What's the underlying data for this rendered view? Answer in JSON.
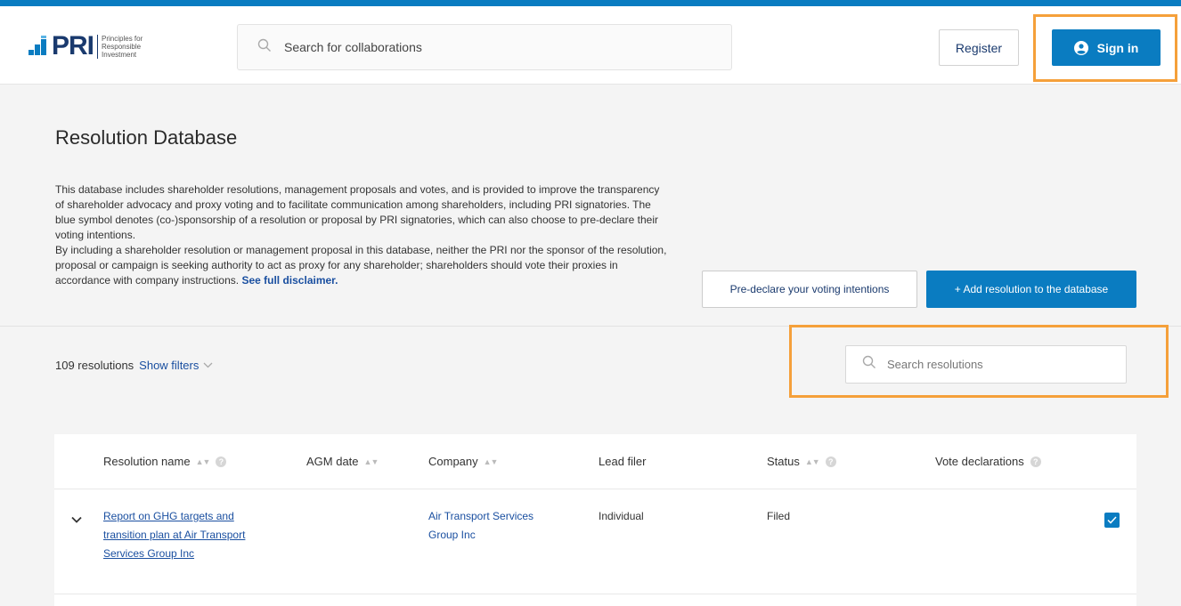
{
  "brand": {
    "name": "PRI",
    "subtitle_lines": [
      "Principles for",
      "Responsible",
      "Investment"
    ],
    "accent": "#0a7cc1"
  },
  "header": {
    "search_placeholder": "Search for collaborations",
    "register_label": "Register",
    "signin_label": "Sign in"
  },
  "page": {
    "title": "Resolution Database",
    "intro_p1": "This database includes shareholder resolutions, management proposals and votes, and is provided to improve the transparency of shareholder advocacy and proxy voting and to facilitate communication among shareholders, including PRI signatories. The blue symbol denotes (co-)sponsorship of a resolution or proposal by PRI signatories, which can also choose to pre-declare their voting intentions.",
    "intro_p2": "By including a shareholder resolution or management proposal in this database, neither the PRI nor the sponsor of the resolution, proposal or campaign is seeking authority to act as proxy for any shareholder; shareholders should vote their proxies in accordance with company instructions.",
    "disclaimer_link": "See full disclaimer.",
    "predeclare_label": "Pre-declare your voting intentions",
    "add_label": "+ Add resolution to the database"
  },
  "results": {
    "count_text": "109 resolutions",
    "show_filters_label": "Show filters",
    "search_placeholder": "Search resolutions"
  },
  "table": {
    "columns": [
      "Resolution name",
      "AGM date",
      "Company",
      "Lead filer",
      "Status",
      "Vote declarations"
    ],
    "rows": [
      {
        "resolution_name": "Report on GHG targets and transition plan at Air Transport Services Group Inc",
        "agm_date": "",
        "company": "Air Transport Services Group Inc",
        "lead_filer": "Individual",
        "status": "Filed",
        "co_sponsored": true
      }
    ]
  },
  "highlight_color": "#f5a03a"
}
